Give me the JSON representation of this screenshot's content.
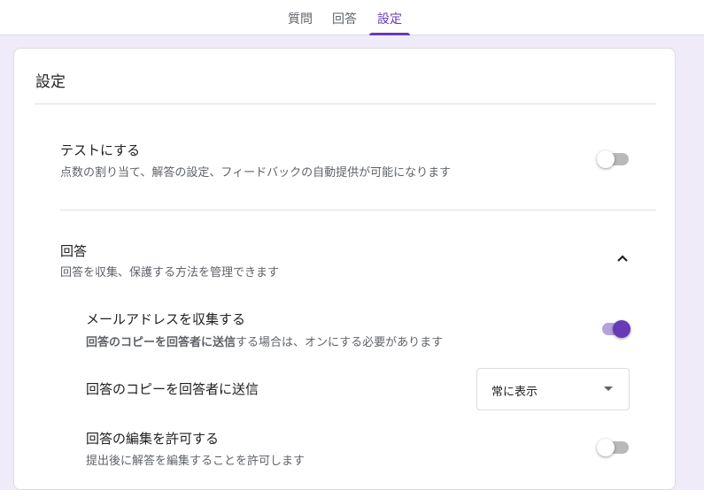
{
  "tabs": [
    {
      "label": "質問",
      "active": false
    },
    {
      "label": "回答",
      "active": false
    },
    {
      "label": "設定",
      "active": true
    }
  ],
  "accent_color": "#673ab7",
  "settings": {
    "title": "設定",
    "quiz": {
      "title": "テストにする",
      "description": "点数の割り当て、解答の設定、フィードバックの自動提供が可能になります",
      "enabled": false
    },
    "responses": {
      "title": "回答",
      "description": "回答を収集、保護する方法を管理できます",
      "expanded": true,
      "collect_email": {
        "title": "メールアドレスを収集する",
        "description_bold": "回答のコピーを回答者に送信",
        "description_rest": "する場合は、オンにする必要があります",
        "enabled": true
      },
      "send_copy": {
        "title": "回答のコピーを回答者に送信",
        "selected": "常に表示"
      },
      "allow_edit": {
        "title": "回答の編集を許可する",
        "description": "提出後に解答を編集することを許可します",
        "enabled": false
      }
    }
  }
}
